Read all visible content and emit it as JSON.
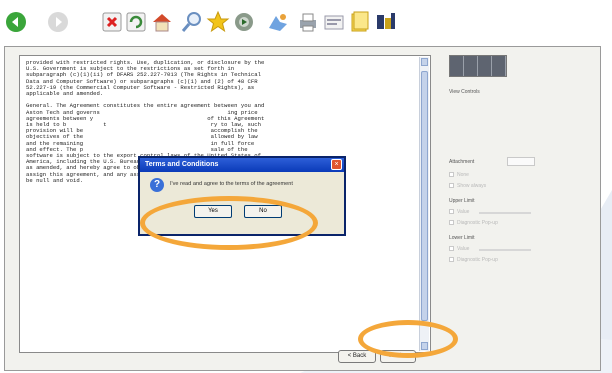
{
  "toolbar": {
    "icons": [
      "back-icon",
      "forward-icon",
      "stop-icon",
      "refresh-icon",
      "home-icon",
      "search-icon",
      "favorites-icon",
      "media-icon",
      "history-icon",
      "print-icon",
      "edit-icon",
      "folder-icon",
      "settings-icon"
    ]
  },
  "license": {
    "text": "provided with restricted rights. Use, duplication, or disclosure by the\nU.S. Government is subject to the restrictions as set forth in\nsubparagraph (c)(1)(ii) of DFARS 252.227-7013 (The Rights in Technical\nData and Computer Software) or subparagraphs (c)(1) and (2) of 48 CFR\n52.227-19 (the Commercial Computer Software - Restricted Rights), as\napplicable and amended.\n\nGeneral. The Agreement constitutes the entire agreement between you and\nAston Tech and governs                                      ing price\nagreements between y                                  of this Agreement\nis held to b           t                               ry to law, such\nprovision will be                                      accomplish the\nobjectives of the                                      allowed by law\nand the remaining                                      in full force\nand effect. The p                                      sale of the\nsoftware is subject to the export control laws of the United States of\nAmerica, including the U.S. Bureau of Export Administration regulations,\nas amended, and hereby agree to obey any and all such laws. You may not\nassign this agreement, and any assignment of this Agreement by you will\nbe null and void."
  },
  "dialog": {
    "title": "Terms and Conditions",
    "message": "I've read and agree to the terms of the agreement",
    "yes_label": "Yes",
    "no_label": "No"
  },
  "nav": {
    "back_label": "< Back",
    "next_label": "Next >"
  },
  "side_panel": {
    "view_controls_label": "View Controls",
    "attachment_label": "Attachment",
    "option1": "None",
    "option2": "Show always",
    "upper_limit_label": "Upper Limit",
    "upper_value": "Value",
    "upper_diag": "Diagnostic Pop-up",
    "lower_limit_label": "Lower Limit",
    "lower_value": "Value",
    "lower_diag": "Diagnostic Pop-up"
  },
  "colors": {
    "highlight": "#f4a73a",
    "dialog_titlebar": "#0a3ab8"
  }
}
